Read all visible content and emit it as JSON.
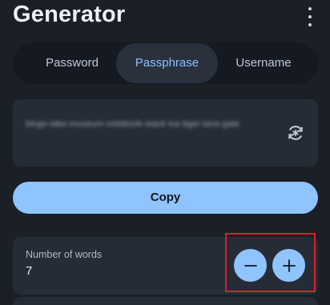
{
  "app_bar": {
    "title": "Generator",
    "menu_icon": "more-vertical-icon"
  },
  "tabs": [
    {
      "label": "Password",
      "active": false
    },
    {
      "label": "Passphrase",
      "active": true
    },
    {
      "label": "Username",
      "active": false
    }
  ],
  "generated": {
    "value": "bingo-lake-museum-notebook-stack-ice-tiger-lane-gate",
    "regenerate_icon": "refresh-sparkle-icon"
  },
  "copy_button": {
    "label": "Copy"
  },
  "number_of_words": {
    "label": "Number of words",
    "value": "7",
    "decrement_icon": "minus-icon",
    "increment_icon": "plus-icon"
  },
  "colors": {
    "background": "#1b1f26",
    "accent": "#8fc4ff",
    "highlight": "#e11d2a"
  }
}
